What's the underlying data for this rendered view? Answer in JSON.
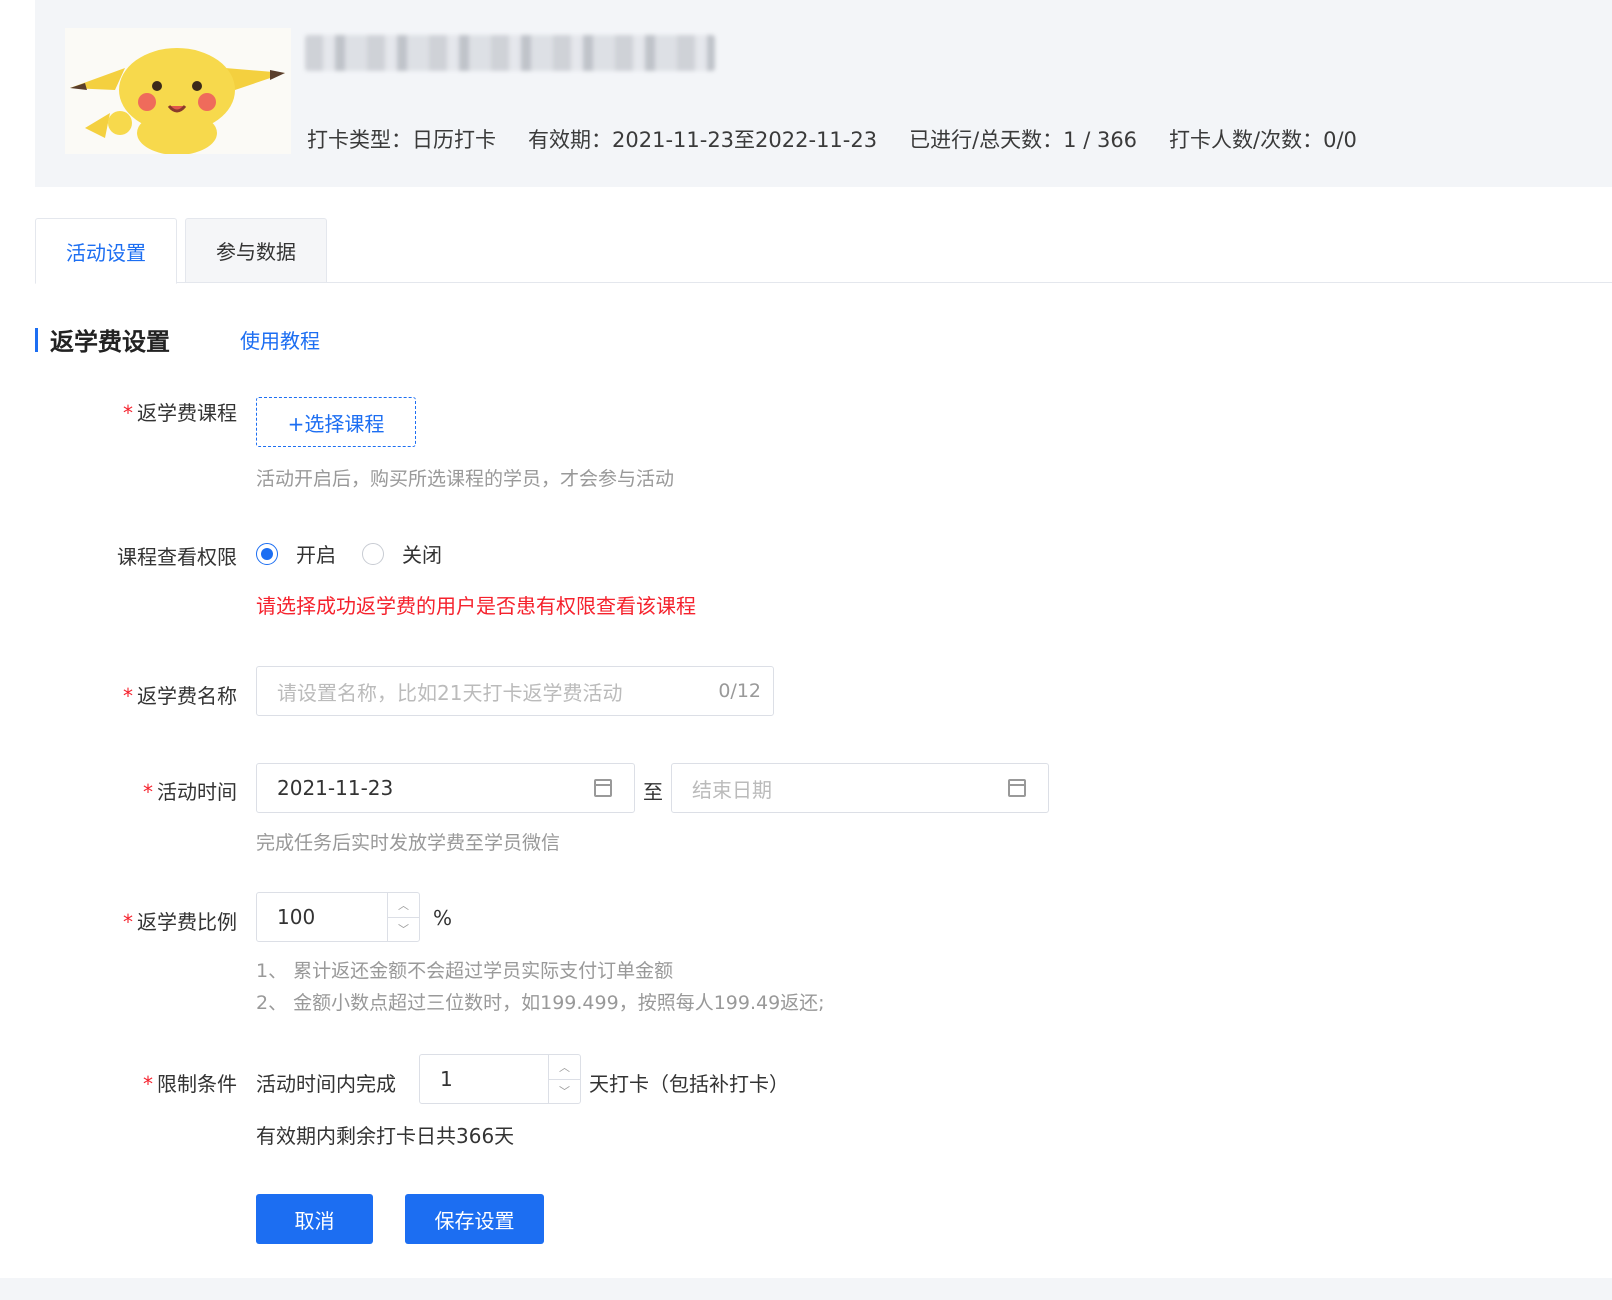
{
  "header": {
    "meta": {
      "type": "打卡类型：日历打卡",
      "validity": "有效期：2021-11-23至2022-11-23",
      "progress": "已进行/总天数：1 / 366",
      "participants": "打卡人数/次数：0/0"
    }
  },
  "tabs": [
    {
      "label": "活动设置",
      "active": true
    },
    {
      "label": "参与数据",
      "active": false
    }
  ],
  "section": {
    "title": "返学费设置",
    "tutorial_link": "使用教程"
  },
  "form": {
    "required_mark": "*",
    "course": {
      "label": "返学费课程",
      "button": "+选择课程",
      "hint": "活动开启后，购买所选课程的学员，才会参与活动"
    },
    "permission": {
      "label": "课程查看权限",
      "options": [
        {
          "label": "开启",
          "checked": true
        },
        {
          "label": "关闭",
          "checked": false
        }
      ],
      "hint": "请选择成功返学费的用户是否患有权限查看该课程"
    },
    "name": {
      "label": "返学费名称",
      "placeholder": "请设置名称，比如21天打卡返学费活动",
      "count": "0/12"
    },
    "time": {
      "label": "活动时间",
      "start": "2021-11-23",
      "separator": "至",
      "end_placeholder": "结束日期",
      "hint": "完成任务后实时发放学费至学员微信"
    },
    "ratio": {
      "label": "返学费比例",
      "value": "100",
      "unit": "%",
      "hints": [
        "1、 累计返还金额不会超过学员实际支付订单金额",
        "2、 金额小数点超过三位数时，如199.499，按照每人199.49返还;"
      ]
    },
    "limit": {
      "label": "限制条件",
      "prefix": "活动时间内完成",
      "value": "1",
      "suffix": "天打卡（包括补打卡）",
      "hint": "有效期内剩余打卡日共366天"
    }
  },
  "actions": {
    "cancel": "取消",
    "save": "保存设置"
  },
  "colors": {
    "accent": "#1c6ef2",
    "danger": "#f5222d"
  }
}
